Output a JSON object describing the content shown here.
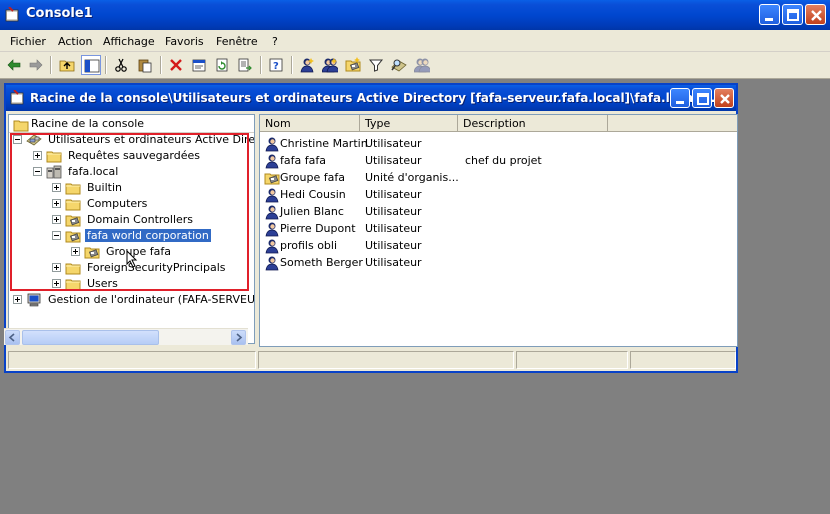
{
  "window": {
    "title": "Console1"
  },
  "menu": [
    "Fichier",
    "Action",
    "Affichage",
    "Favoris",
    "Fenêtre",
    "?"
  ],
  "toolbar": [
    "back-arrow-icon",
    "forward-arrow-icon",
    "up-folder-icon",
    "show-hide-tree-icon",
    "cut-icon",
    "paste-icon",
    "delete-icon",
    "properties-icon",
    "refresh-icon",
    "export-list-icon",
    "help-icon",
    "new-user-icon",
    "new-group-icon",
    "new-ou-icon",
    "filter-icon",
    "find-icon",
    "add-to-group-icon"
  ],
  "child_window": {
    "title": "Racine de la console\\Utilisateurs et ordinateurs Active Directory [fafa-serveur.fafa.local]\\fafa.local\\..."
  },
  "tree": {
    "header": "Racine de la console",
    "nodes": [
      {
        "label": "Utilisateurs et ordinateurs Active Director",
        "icon": "ad-users-computers-icon",
        "expander": "minus"
      },
      {
        "label": "Requêtes sauvegardées",
        "icon": "folder-icon",
        "expander": "plus"
      },
      {
        "label": "fafa.local",
        "icon": "domain-icon",
        "expander": "minus"
      },
      {
        "label": "Builtin",
        "icon": "folder-icon",
        "expander": "plus"
      },
      {
        "label": "Computers",
        "icon": "folder-icon",
        "expander": "plus"
      },
      {
        "label": "Domain Controllers",
        "icon": "ou-icon",
        "expander": "plus"
      },
      {
        "label": "fafa world corporation",
        "icon": "ou-icon",
        "expander": "minus",
        "selected": true
      },
      {
        "label": "Groupe fafa",
        "icon": "ou-icon",
        "expander": "plus"
      },
      {
        "label": "ForeignSecurityPrincipals",
        "icon": "folder-icon",
        "expander": "plus"
      },
      {
        "label": "Users",
        "icon": "folder-icon",
        "expander": "plus"
      },
      {
        "label": "Gestion de l'ordinateur (FAFA-SERVEUR.F",
        "icon": "computer-management-icon",
        "expander": "plus"
      }
    ]
  },
  "list": {
    "columns": [
      "Nom",
      "Type",
      "Description"
    ],
    "rows": [
      {
        "name": "Christine Martin",
        "type": "Utilisateur",
        "description": "",
        "icon": "user-icon"
      },
      {
        "name": "fafa fafa",
        "type": "Utilisateur",
        "description": "chef du projet",
        "icon": "user-icon"
      },
      {
        "name": "Groupe fafa",
        "type": "Unité d'organis...",
        "description": "",
        "icon": "ou-icon"
      },
      {
        "name": "Hedi Cousin",
        "type": "Utilisateur",
        "description": "",
        "icon": "user-icon"
      },
      {
        "name": "Julien Blanc",
        "type": "Utilisateur",
        "description": "",
        "icon": "user-icon"
      },
      {
        "name": "Pierre Dupont",
        "type": "Utilisateur",
        "description": "",
        "icon": "user-icon"
      },
      {
        "name": "profils obli",
        "type": "Utilisateur",
        "description": "",
        "icon": "user-icon"
      },
      {
        "name": "Someth Berger",
        "type": "Utilisateur",
        "description": "",
        "icon": "user-icon"
      }
    ]
  },
  "colors": {
    "titlebar": "#0047cf",
    "selection": "#316ac5",
    "highlight_box": "#e0202a",
    "chrome": "#ece9d8",
    "desktop": "#808080"
  }
}
